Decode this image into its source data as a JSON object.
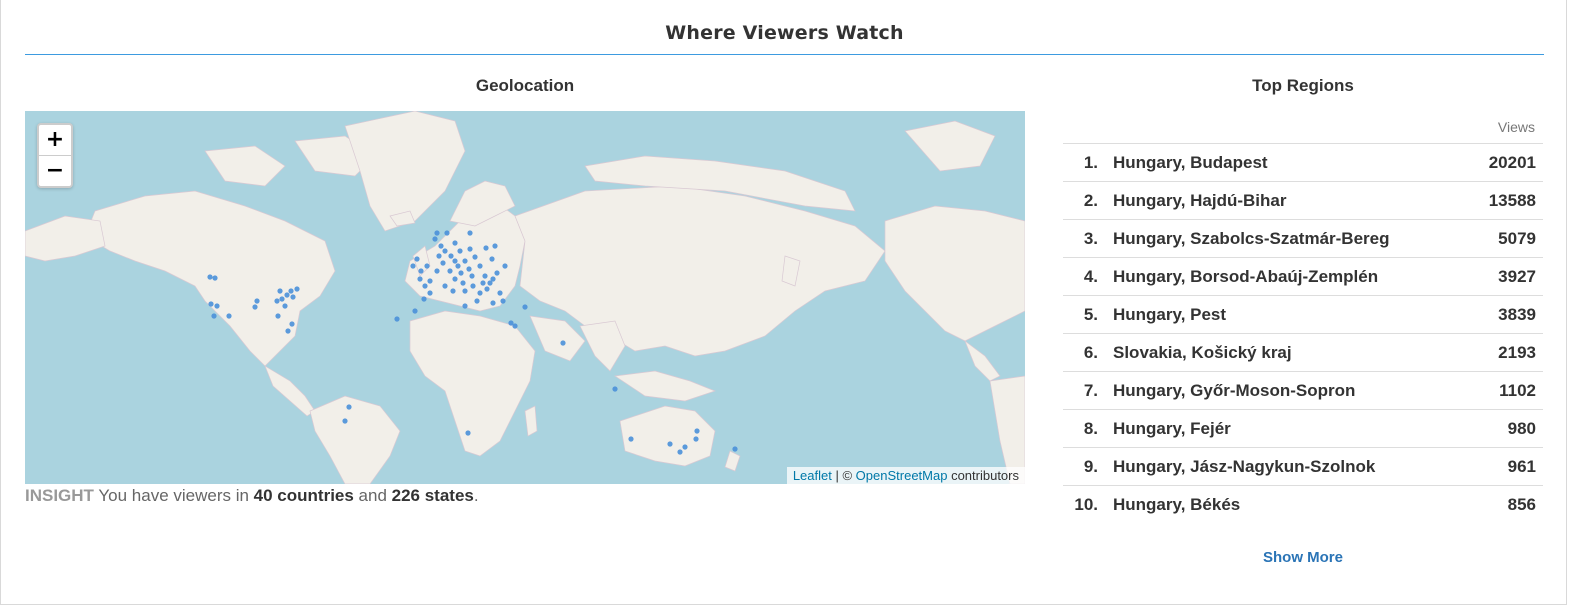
{
  "section_title": "Where Viewers Watch",
  "geolocation": {
    "title": "Geolocation",
    "zoom_in": "+",
    "zoom_out": "−",
    "attribution": {
      "leaflet": "Leaflet",
      "separator": " | © ",
      "osm": "OpenStreetMap",
      "suffix": " contributors"
    },
    "marker_color": "#4a90d9"
  },
  "insight": {
    "label": "INSIGHT",
    "text1": " You have viewers in ",
    "countries": "40 countries",
    "text2": " and ",
    "states": "226 states",
    "text3": "."
  },
  "top_regions": {
    "title": "Top Regions",
    "views_header": "Views",
    "rows": [
      {
        "rank": "1.",
        "name": "Hungary, Budapest",
        "views": "20201"
      },
      {
        "rank": "2.",
        "name": "Hungary, Hajdú-Bihar",
        "views": "13588"
      },
      {
        "rank": "3.",
        "name": "Hungary, Szabolcs-Szatmár-Bereg",
        "views": "5079"
      },
      {
        "rank": "4.",
        "name": "Hungary, Borsod-Abaúj-Zemplén",
        "views": "3927"
      },
      {
        "rank": "5.",
        "name": "Hungary, Pest",
        "views": "3839"
      },
      {
        "rank": "6.",
        "name": "Slovakia, Košický kraj",
        "views": "2193"
      },
      {
        "rank": "7.",
        "name": "Hungary, Győr-Moson-Sopron",
        "views": "1102"
      },
      {
        "rank": "8.",
        "name": "Hungary, Fejér",
        "views": "980"
      },
      {
        "rank": "9.",
        "name": "Hungary, Jász-Nagykun-Szolnok",
        "views": "961"
      },
      {
        "rank": "10.",
        "name": "Hungary, Békés",
        "views": "856"
      }
    ],
    "show_more": "Show More"
  }
}
